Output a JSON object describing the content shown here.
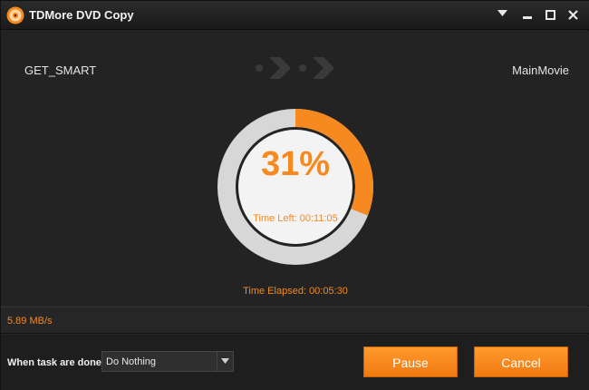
{
  "window": {
    "title": "TDMore DVD Copy",
    "controls": [
      "menu",
      "minimize",
      "maximize",
      "close"
    ]
  },
  "copy": {
    "source_name": "GET_SMART",
    "target_name": "MainMovie",
    "progress_percent_label": "31%",
    "progress_value": 0.31,
    "time_left_label": "Time Left:",
    "time_left_value": "00:11:05",
    "time_elapsed_label": "Time Elapsed:",
    "time_elapsed_value": "00:05:30",
    "speed": "5.89 MB/s"
  },
  "footer": {
    "when_done_label": "When task are done:",
    "when_done_selected": "Do Nothing",
    "pause_label": "Pause",
    "cancel_label": "Cancel"
  },
  "colors": {
    "accent": "#f6891f",
    "ring_track": "#d7d7d7",
    "ring_fill": "#f6891f",
    "inner_disc": "#f3f3f3"
  },
  "icons": {
    "logo": "tdmore-logo-icon",
    "flow_arrows": "double-arrow-icon",
    "dropdown": "chevron-down-icon"
  }
}
